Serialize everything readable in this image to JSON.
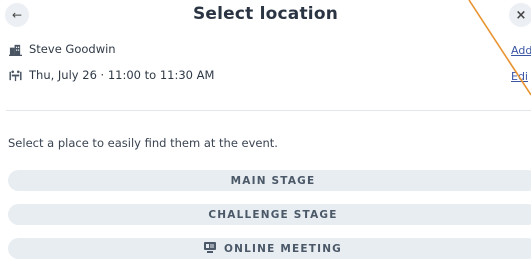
{
  "header": {
    "title": "Select location",
    "back_icon": "arrow-left-icon",
    "close_icon": "close-icon",
    "back_glyph": "←",
    "close_glyph": "×"
  },
  "meeting": {
    "person": "Steve Goodwin",
    "datetime": "Thu, July 26 · 11:00 to 11:30 AM",
    "add_label": "Add",
    "edit_label": "Edi"
  },
  "locations": {
    "hint": "Select a place to easily find them at the event.",
    "items": [
      {
        "label": "MAIN STAGE"
      },
      {
        "label": "CHALLENGE STAGE"
      },
      {
        "label": "ONLINE MEETING",
        "icon": "video-icon"
      }
    ]
  },
  "colors": {
    "accent_line": "#e8932f",
    "button_bg": "#e8edf1",
    "link": "#3a55a4"
  }
}
